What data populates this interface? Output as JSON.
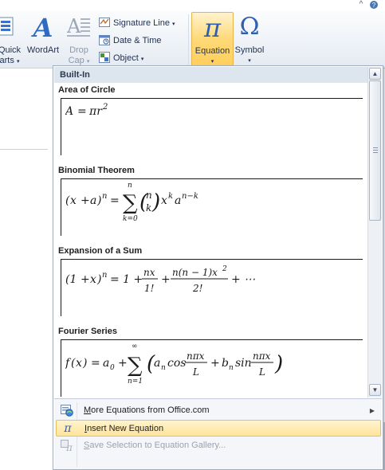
{
  "window": {
    "controls": [
      "^",
      "?"
    ]
  },
  "ribbon": {
    "quick_parts": {
      "line1": "Quick",
      "line2": "arts"
    },
    "wordart": {
      "label": "WordArt"
    },
    "drop_cap": {
      "line1": "Drop",
      "line2": "Cap"
    },
    "signature_line": {
      "label": "Signature Line"
    },
    "date_time": {
      "label": "Date & Time"
    },
    "object": {
      "label": "Object"
    },
    "equation": {
      "label": "Equation",
      "glyph": "π"
    },
    "symbol": {
      "label": "Symbol",
      "glyph": "Ω"
    }
  },
  "gallery": {
    "header": "Built-In",
    "items": [
      {
        "title": "Area of Circle",
        "equation": "A = πr²"
      },
      {
        "title": "Binomial Theorem",
        "equation": "(x + a)^n = Σ_{k=0}^{n} (n choose k) x^k a^{n−k}"
      },
      {
        "title": "Expansion of a Sum",
        "equation": "(1 + x)^n = 1 + nx/1! + n(n − 1)x²/2! + ⋯"
      },
      {
        "title": "Fourier Series",
        "equation": "f(x) = a₀ + Σ_{n=1}^{∞} (a_n cos(nπx/L) + b_n sin(nπx/L))"
      }
    ]
  },
  "menu": {
    "more_equations": {
      "label": "More Equations from Office.com",
      "accel": "M",
      "rest": "ore Equations from Office.com"
    },
    "insert_new": {
      "label": "Insert New Equation",
      "accel": "I",
      "rest": "nsert New Equation"
    },
    "save_selection": {
      "label": "Save Selection to Equation Gallery...",
      "accel": "S",
      "rest": "ave Selection to Equation Gallery..."
    }
  },
  "colors": {
    "ribbon_blue": "#1e3050",
    "equation_highlight": "#ffd978",
    "menu_hover": "#ffe49a"
  }
}
